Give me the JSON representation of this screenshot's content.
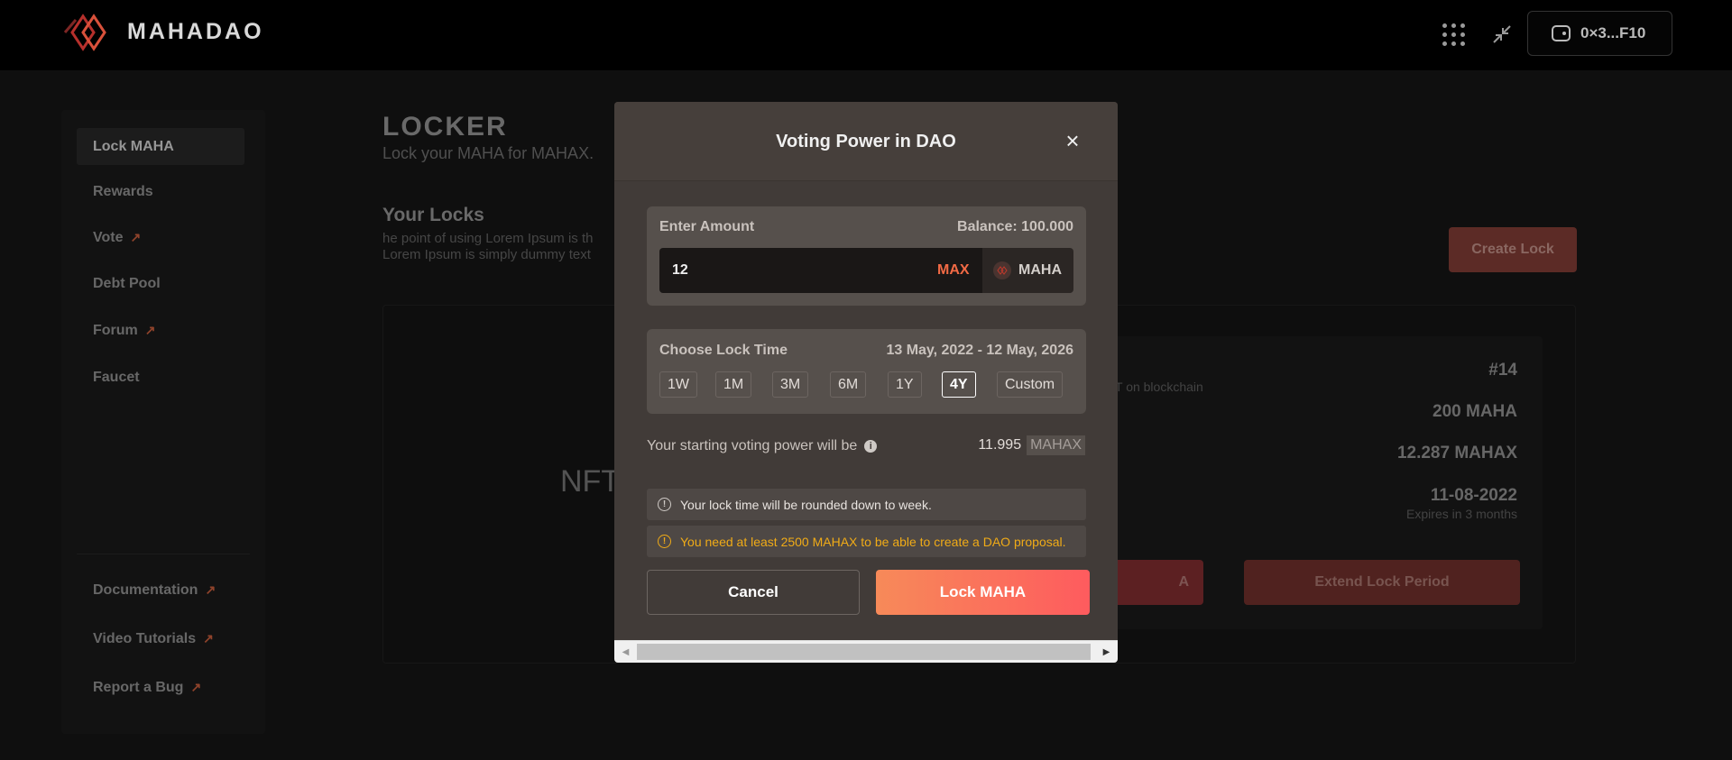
{
  "header": {
    "brand": "MAHADAO",
    "wallet_address": "0×3...F10"
  },
  "sidebar": {
    "items": [
      {
        "label": "Lock MAHA",
        "active": true,
        "external": false
      },
      {
        "label": "Rewards",
        "active": false,
        "external": false
      },
      {
        "label": "Vote",
        "active": false,
        "external": true
      },
      {
        "label": "Debt Pool",
        "active": false,
        "external": false
      },
      {
        "label": "Forum",
        "active": false,
        "external": true
      },
      {
        "label": "Faucet",
        "active": false,
        "external": false
      }
    ],
    "bottom_items": [
      {
        "label": "Documentation",
        "external": true
      },
      {
        "label": "Video Tutorials",
        "external": true
      },
      {
        "label": "Report a Bug",
        "external": true
      }
    ]
  },
  "main": {
    "title": "LOCKER",
    "subtitle": "Lock your MAHA for MAHAX.",
    "locks_title": "Your Locks",
    "locks_desc_1": "he point of using Lorem Ipsum is th",
    "locks_desc_2": "Lorem Ipsum is simply dummy text",
    "create_lock_label": "Create Lock",
    "nft_label": "NFT",
    "lock_detail": {
      "id": "#14",
      "chain_note": "T on blockchain",
      "amount": "200 MAHA",
      "mahax": "12.287 MAHAX",
      "date": "11-08-2022",
      "expires": "Expires in 3 months",
      "button1_label": "A",
      "button2_label": "Extend Lock Period"
    }
  },
  "modal": {
    "title": "Voting Power in DAO",
    "amount": {
      "label": "Enter Amount",
      "balance": "Balance: 100.000",
      "value": "12",
      "max_label": "MAX",
      "token": "MAHA"
    },
    "lock_time": {
      "label": "Choose Lock Time",
      "range": "13 May, 2022 - 12 May, 2026",
      "options": [
        "1W",
        "1M",
        "3M",
        "6M",
        "1Y",
        "4Y",
        "Custom"
      ],
      "selected": "4Y"
    },
    "voting_power": {
      "label": "Your starting voting power will be",
      "value": "11.995",
      "unit": "MAHAX"
    },
    "notices": {
      "info": "Your lock time will be rounded down to week.",
      "warning": "You need at least 2500 MAHAX to be able to create a DAO proposal."
    },
    "cancel_label": "Cancel",
    "submit_label": "Lock MAHA"
  },
  "colors": {
    "accent": "#f26a45",
    "warning": "#f0ab17",
    "gradient_start": "#f78a59",
    "gradient_end": "#fe5b5e"
  }
}
